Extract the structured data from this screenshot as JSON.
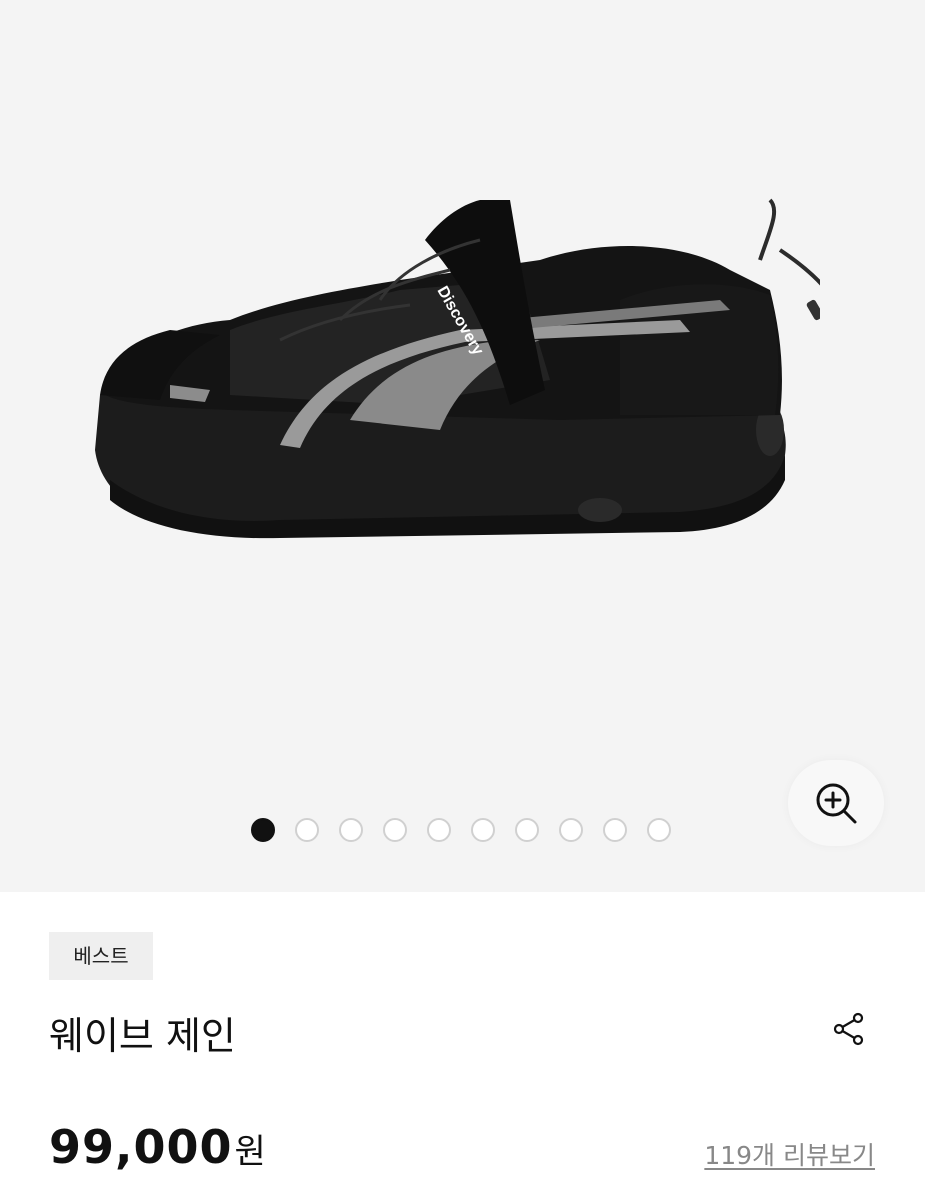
{
  "gallery": {
    "image_alt": "Discovery Expedition shoe",
    "brand_on_product": "Discovery",
    "slide_count": 10,
    "active_slide": 1
  },
  "product": {
    "badge": "베스트",
    "title": "웨이브 제인",
    "price_amount": "99,000",
    "price_unit": "원",
    "review_link": "119개 리뷰보기"
  },
  "icons": {
    "zoom": "zoom-in-icon",
    "share": "share-icon"
  },
  "colors": {
    "gallery_bg": "#f4f4f4",
    "active_dot": "#111111",
    "inactive_dot_border": "#d0d0d0",
    "badge_bg": "#efefef",
    "review_link": "#888888"
  }
}
